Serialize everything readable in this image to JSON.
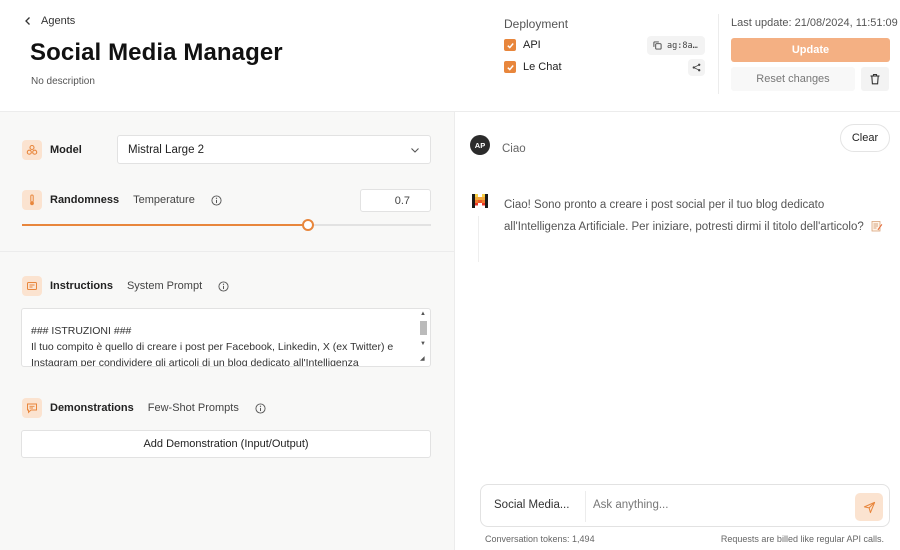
{
  "header": {
    "back_label": "Agents",
    "title": "Social Media Manager",
    "description": "No description",
    "deployment_label": "Deployment",
    "deployments": [
      {
        "label": "API",
        "checked": true
      },
      {
        "label": "Le Chat",
        "checked": true
      }
    ],
    "agent_id": "ag:8a…",
    "last_update": "Last update: 21/08/2024, 11:51:09",
    "update_label": "Update",
    "reset_label": "Reset changes"
  },
  "config": {
    "model_label": "Model",
    "model_value": "Mistral Large 2",
    "randomness_label": "Randomness",
    "temperature_label": "Temperature",
    "temperature_value": "0.7",
    "temperature_fraction": 0.7,
    "instructions_label": "Instructions",
    "system_prompt_label": "System Prompt",
    "system_prompt_text": "### ISTRUZIONI ###\nIl tuo compito è quello di creare i post per Facebook, Linkedin, X (ex Twitter) e Instagram per condividere gli articoli di un blog dedicato all'Intelligenza",
    "demonstrations_label": "Demonstrations",
    "few_shot_label": "Few-Shot Prompts",
    "add_demo_label": "Add Demonstration (Input/Output)"
  },
  "chat": {
    "clear_label": "Clear",
    "user_initials": "AP",
    "user_message": "Ciao",
    "assistant_message": "Ciao! Sono pronto a creare i post social per il tuo blog dedicato all'Intelligenza Artificiale. Per iniziare, potresti dirmi il titolo dell'articolo?",
    "agent_selector": "Social Media...",
    "input_placeholder": "Ask anything...",
    "tokens_text": "Conversation tokens: 1,494",
    "billing_text": "Requests are billed like regular API calls."
  },
  "colors": {
    "accent": "#e8863c",
    "accent_light": "#f4b083",
    "icon_bg": "#fbe3d0"
  },
  "icons": [
    "chevron-left-icon",
    "check-icon",
    "copy-icon",
    "share-icon",
    "trash-icon",
    "model-icon",
    "thermometer-icon",
    "info-icon",
    "instructions-icon",
    "demonstrations-icon",
    "chevron-down-icon",
    "mistral-logo-icon",
    "memo-icon",
    "send-icon"
  ]
}
